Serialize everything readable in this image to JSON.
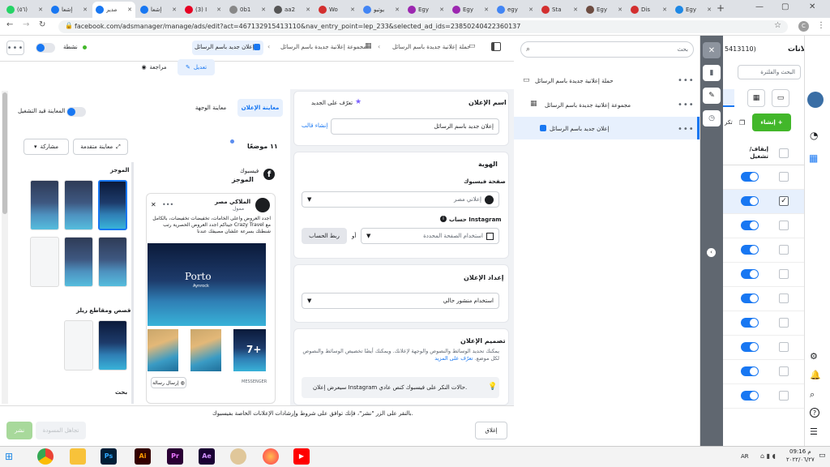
{
  "browser": {
    "tabs": [
      {
        "label": "(٥٦)",
        "color": "#25d366"
      },
      {
        "label": "إشعا",
        "color": "#1877f2"
      },
      {
        "label": "مدير",
        "color": "#1877f2"
      },
      {
        "label": "إشعا",
        "color": "#1877f2"
      },
      {
        "label": "(3) I",
        "color": "#e60023"
      },
      {
        "label": "0b1",
        "color": "#888888"
      },
      {
        "label": "aa2",
        "color": "#555555"
      },
      {
        "label": "Wo",
        "color": "#d32f2f"
      },
      {
        "label": "يوتيو",
        "color": "#4285f4"
      },
      {
        "label": "Egy",
        "color": "#9c27b0"
      },
      {
        "label": "Egy",
        "color": "#9c27b0"
      },
      {
        "label": "egy",
        "color": "#4285f4"
      },
      {
        "label": "Sta",
        "color": "#d32f2f"
      },
      {
        "label": "Egy",
        "color": "#6d4c41"
      },
      {
        "label": "Dis",
        "color": "#d32f2f"
      },
      {
        "label": "Egy",
        "color": "#1e88e5"
      }
    ],
    "url": "facebook.com/adsmanager/manage/ads/edit?act=467132915413110&nav_entry_point=lep_233&selected_ad_ids=23850240422360137"
  },
  "topbar": {
    "status_label": "نشطة",
    "crumb_campaign": "حملة إعلانية جديدة باسم الرسائل",
    "crumb_adset": "مجموعة إعلانية جديدة باسم الرسائل",
    "crumb_ad": "إعلان جديد باسم الرسائل",
    "edit_label": "تعديل",
    "review_label": "مراجعة"
  },
  "preview": {
    "tab_ad_preview": "معاينة الإعلان",
    "tab_landing_preview": "معاينة الوجهة",
    "live_preview_label": "المعاينة قيد التشغيل",
    "placements_count": "١١ موضعًا",
    "advanced_preview": "معاينة متقدمة",
    "share": "مشاركة",
    "fb_label": "فيسبوك",
    "feeds_label": "الموجز",
    "section_feeds": "الموجز",
    "section_stories": "قصص ومقاطع ريلز",
    "section_search": "بحث",
    "post": {
      "page_name": "الملاكي مصر",
      "sponsored": "ممول",
      "text": "اجدد العروض واعلى الخامات، تخفيضات تخفيضات، بالكامل مع Crazy Travel جيناكم اجدد العروض الحصرية رتب شنطتك بسرعة علشان مصيفك عندنا",
      "image_brand": "Porto",
      "image_sub": "Aynrock",
      "more_count": "7+",
      "messenger": "MESSENGER",
      "send_message": "إرسال رسالة"
    }
  },
  "form": {
    "ad_name_title": "اسم الإعلان",
    "learn_new": "تعرّف على الجديد",
    "ad_name_value": "إعلان جديد باسم الرسائل",
    "create_template": "إنشاء قالب",
    "identity_title": "الهوية",
    "fb_page_label": "صفحة فيسبوك",
    "fb_page_value": "إعلاني مصر",
    "ig_account_label": "حساب Instagram",
    "ig_account_value": "استخدام الصفحة المحددة",
    "or_label": "أو",
    "link_account": "ربط الحساب",
    "ad_setup_title": "إعداد الإعلان",
    "ad_setup_value": "استخدام منشور حالي",
    "ad_design_title": "تصميم الإعلان",
    "ad_design_desc": "يمكنك تحديد الوسائط والنصوص والوجهة لإعلانك. ويمكنك أيضًا تخصيص الوسائط والنصوص لكل موضع.",
    "learn_more": "تعرّف على المزيد",
    "ig_notice": "سيعرض إعلان Instagram حالات النكر على فيسبوك كنص عادي."
  },
  "bottom": {
    "terms": "بالنقر على الزر \"نشر\"، فإنك توافق على شروط وإرشادات الإعلانات الخاصة بفيسبوك.",
    "close": "إغلاق",
    "back_draft": "تجاهل المسودة",
    "publish": "نشر"
  },
  "tree": {
    "search_placeholder": "بحث",
    "campaign": "حملة إعلانية جديدة باسم الرسائل",
    "adset": "مجموعة إعلانية جديدة باسم الرسائل",
    "ad": "إعلان جديد باسم الرسائل"
  },
  "right": {
    "title": "الإعلانات",
    "account_suffix": "5413110)",
    "search_placeholder": "البحث والفلترة",
    "create": "إنشاء",
    "duplicate_short": "تكر",
    "col_on_off": "إيقاف/ تشغيل"
  },
  "taskbar": {
    "lang": "AR",
    "time": "09:16 م",
    "date": "٢٠٢٢/٠٦/٢٧"
  },
  "colors": {
    "fb_blue": "#1877f2",
    "green": "#42b72a",
    "toolstrip": "#606770"
  }
}
